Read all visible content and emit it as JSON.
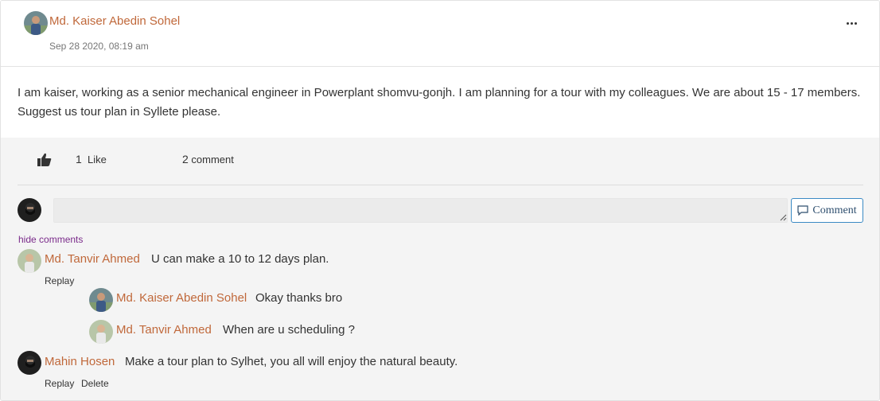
{
  "post": {
    "author": "Md. Kaiser Abedin Sohel",
    "date": "Sep 28 2020, 08:19 am",
    "body": "I am kaiser, working as a senior mechanical engineer in Powerplant shomvu-gonjh. I am planning for a tour with my colleagues. We are about 15 - 17 members. Suggest us tour plan in Syllete please.",
    "menu_icon": "ellipsis-icon"
  },
  "stats": {
    "like_icon": "thumbs-up-icon",
    "like_count": "1",
    "like_label": "Like",
    "comment_count": "2",
    "comment_label": "comment"
  },
  "composer": {
    "value": "",
    "button_label": "Comment",
    "button_icon": "speech-bubble-icon"
  },
  "toggle_label": "hide comments",
  "comments": [
    {
      "author": "Md. Tanvir Ahmed",
      "text": "U can make a 10 to 12 days plan.",
      "actions": [
        "Replay"
      ]
    },
    {
      "author": "Md. Kaiser Abedin Sohel",
      "text": "Okay thanks bro"
    },
    {
      "author": "Md. Tanvir Ahmed",
      "text": "When are u scheduling ?"
    },
    {
      "author": "Mahin Hosen",
      "text": "Make a tour plan to Sylhet, you all will enjoy the natural beauty.",
      "actions": [
        "Replay",
        "Delete"
      ]
    }
  ],
  "colors": {
    "author_name": "#c0683a",
    "link_purple": "#7a2a8a",
    "button_border": "#3b8ac4",
    "gray_bg": "#f4f4f4"
  }
}
